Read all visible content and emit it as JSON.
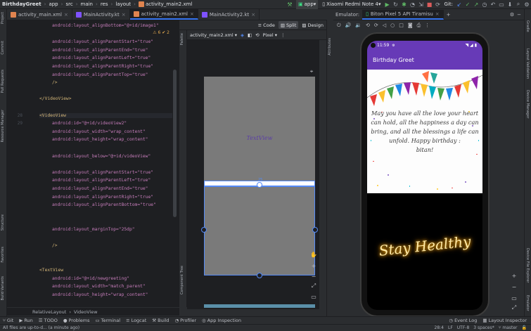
{
  "titlebar": {
    "project": "BirthdayGreet",
    "breadcrumbs": [
      "app",
      "src",
      "main",
      "res",
      "layout",
      "activity_main2.xml"
    ],
    "run_config": "app",
    "device": "Xiaomi Redmi Note 4",
    "git_label": "Git:"
  },
  "tabs": [
    {
      "label": "activity_main.xml",
      "type": "xml",
      "active": false
    },
    {
      "label": "MainActivity.kt",
      "type": "kt",
      "active": false
    },
    {
      "label": "activity_main2.xml",
      "type": "xml",
      "active": true
    },
    {
      "label": "MainActivity2.kt",
      "type": "kt",
      "active": false
    }
  ],
  "left_tools": [
    "Project",
    "Commit",
    "Pull Requests",
    "Resource Manager",
    "Structure",
    "Favorites",
    "Build Variants"
  ],
  "editor": {
    "warnings": "⚠ 6  ✔ 2",
    "lines": [
      {
        "n": "",
        "text": "android:layout_alignBottom=\"@+id/image1\""
      },
      {
        "n": "",
        "text": ""
      },
      {
        "n": "",
        "text": "android:layout_alignParentStart=\"true\""
      },
      {
        "n": "",
        "text": "android:layout_alignParentEnd=\"true\""
      },
      {
        "n": "",
        "text": "android:layout_alignParentLeft=\"true\""
      },
      {
        "n": "",
        "text": "android:layout_alignParentRight=\"true\""
      },
      {
        "n": "",
        "text": "android:layout_alignParentTop=\"true\""
      },
      {
        "n": "",
        "text": "/>"
      },
      {
        "n": "",
        "text": ""
      },
      {
        "n": "",
        "text": "</VideoView>"
      },
      {
        "n": "",
        "text": ""
      },
      {
        "n": "28",
        "text": "<VideoView"
      },
      {
        "n": "29",
        "text": "android:id=\"@+id/videoView2\""
      },
      {
        "n": "",
        "text": "android:layout_width=\"wrap_content\""
      },
      {
        "n": "",
        "text": "android:layout_height=\"wrap_content\""
      },
      {
        "n": "",
        "text": ""
      },
      {
        "n": "",
        "text": "android:layout_below=\"@+id/videoView\""
      },
      {
        "n": "",
        "text": ""
      },
      {
        "n": "",
        "text": "android:layout_alignParentStart=\"true\""
      },
      {
        "n": "",
        "text": "android:layout_alignParentLeft=\"true\""
      },
      {
        "n": "",
        "text": "android:layout_alignParentEnd=\"true\""
      },
      {
        "n": "",
        "text": "android:layout_alignParentRight=\"true\""
      },
      {
        "n": "",
        "text": "android:layout_alignParentBottom=\"true\""
      },
      {
        "n": "",
        "text": ""
      },
      {
        "n": "",
        "text": ""
      },
      {
        "n": "",
        "text": "android:layout_marginTop=\"25dp\""
      },
      {
        "n": "",
        "text": ""
      },
      {
        "n": "",
        "text": "/>"
      },
      {
        "n": "",
        "text": ""
      },
      {
        "n": "",
        "text": ""
      },
      {
        "n": "",
        "text": "<TextView"
      },
      {
        "n": "",
        "text": "android:id=\"@+id/newgreeting\""
      },
      {
        "n": "",
        "text": "android:layout_width=\"match_parent\""
      },
      {
        "n": "",
        "text": "android:layout_height=\"wrap_content\""
      }
    ],
    "breadcrumb": [
      "RelativeLayout",
      "VideoView"
    ]
  },
  "split_modes": [
    "Code",
    "Split",
    "Design"
  ],
  "design": {
    "file_dropdown": "activity_main2.xml",
    "device_dropdown": "Pixel",
    "palette_label": "Palette",
    "component_tree_label": "Component Tree",
    "attributes_label": "Attributes",
    "textview_preview": "TextView",
    "margin_badge": "25"
  },
  "emulator": {
    "label": "Emulator:",
    "device_tab": "Biton Pixel 5 API Tiramisu",
    "time": "11:59",
    "app_title": "Birthday Greet",
    "greeting": "May you have all the love your heart can hold, all the happiness a day can bring, and all the blessings a life can unfold. Happy birthday :\nbitan!",
    "video_text": "Stay Healthy"
  },
  "right_tools": [
    "Gradle",
    "Layout Validation",
    "Device Manager",
    "Device File Explorer",
    "Emulator"
  ],
  "bottom_tools": [
    "Git",
    "Run",
    "TODO",
    "Problems",
    "Terminal",
    "Logcat",
    "Build",
    "Profiler",
    "App Inspection",
    "Event Log",
    "Layout Inspector"
  ],
  "statusbar": {
    "message": "All files are up-to-d... (a minute ago)",
    "position": "28:4",
    "line_sep": "LF",
    "encoding": "UTF-8",
    "indent": "3 spaces*",
    "branch": "master"
  },
  "colors": {
    "accent": "#3574f0",
    "app_purple": "#673ab7",
    "blueprint": "#7a7a7a"
  }
}
